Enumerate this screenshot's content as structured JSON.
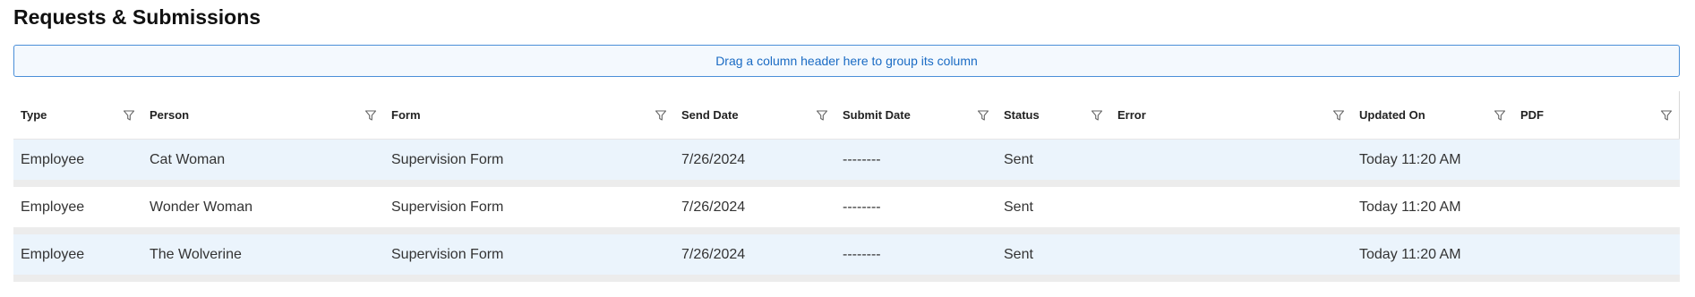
{
  "page": {
    "title": "Requests & Submissions"
  },
  "group_panel": {
    "text": "Drag a column header here to group its column"
  },
  "columns": [
    {
      "key": "type",
      "label": "Type"
    },
    {
      "key": "person",
      "label": "Person"
    },
    {
      "key": "form",
      "label": "Form"
    },
    {
      "key": "send_date",
      "label": "Send Date"
    },
    {
      "key": "submit_date",
      "label": "Submit Date"
    },
    {
      "key": "status",
      "label": "Status"
    },
    {
      "key": "error",
      "label": "Error"
    },
    {
      "key": "updated_on",
      "label": "Updated On"
    },
    {
      "key": "pdf",
      "label": "PDF"
    }
  ],
  "rows": [
    {
      "type": "Employee",
      "person": "Cat Woman",
      "form": "Supervision Form",
      "send_date": "7/26/2024",
      "submit_date": "--------",
      "status": "Sent",
      "error": "",
      "updated_on": "Today 11:20 AM",
      "pdf": ""
    },
    {
      "type": "Employee",
      "person": "Wonder Woman",
      "form": "Supervision Form",
      "send_date": "7/26/2024",
      "submit_date": "--------",
      "status": "Sent",
      "error": "",
      "updated_on": "Today 11:20 AM",
      "pdf": ""
    },
    {
      "type": "Employee",
      "person": "The Wolverine",
      "form": "Supervision Form",
      "send_date": "7/26/2024",
      "submit_date": "--------",
      "status": "Sent",
      "error": "",
      "updated_on": "Today 11:20 AM",
      "pdf": ""
    }
  ],
  "icons": {
    "filter": "filter-icon"
  },
  "colors": {
    "accent": "#1a6bc4",
    "row_alt_background": "#ebf4fc",
    "group_panel_border": "#4a8fd8"
  }
}
